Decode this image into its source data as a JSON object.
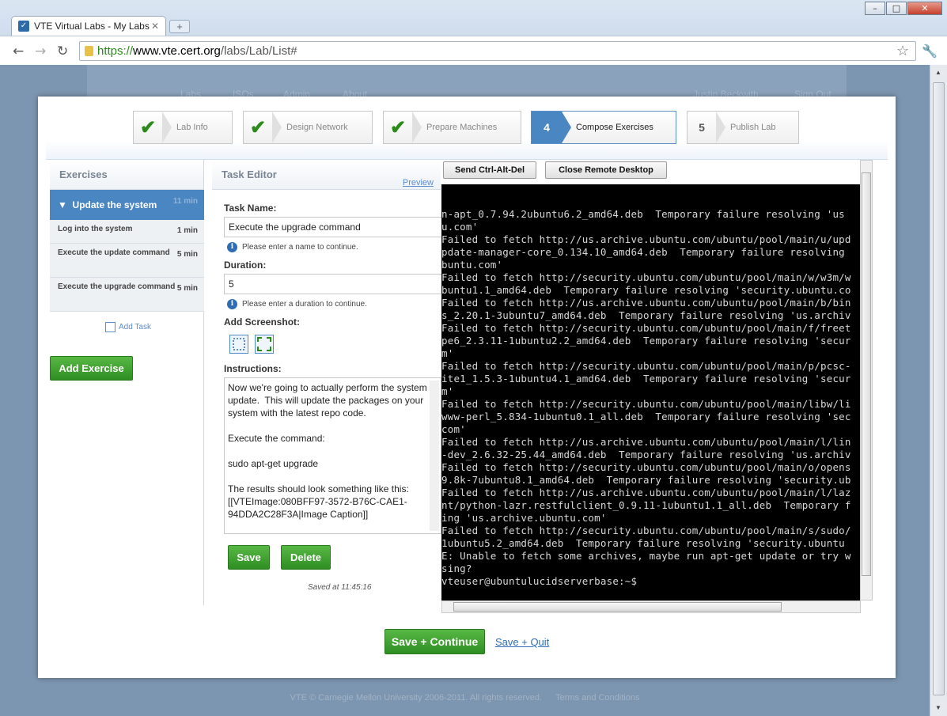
{
  "browser": {
    "tab_title": "VTE Virtual Labs - My Labs",
    "url_scheme": "https://",
    "url_host": "www.vte.cert.org",
    "url_path": "/labs/Lab/List#"
  },
  "site": {
    "nav": [
      "Labs",
      "ISOs",
      "Admin",
      "About"
    ],
    "user": "Justin Beckwith",
    "signout": "Sign Out",
    "footer": "VTE © Carnegie Mellon University 2006-2011. All rights reserved.",
    "footer_link": "Terms and Conditions"
  },
  "wizard": {
    "steps": [
      {
        "label": "Lab Info",
        "state": "done"
      },
      {
        "label": "Design Network",
        "state": "done"
      },
      {
        "label": "Prepare Machines",
        "state": "done"
      },
      {
        "num": "4",
        "label": "Compose Exercises",
        "state": "active"
      },
      {
        "num": "5",
        "label": "Publish Lab",
        "state": "pending"
      }
    ]
  },
  "exercises": {
    "header": "Exercises",
    "selected": {
      "title": "Update the system",
      "duration": "11 min"
    },
    "tasks": [
      {
        "title": "Log into the system",
        "duration": "1 min"
      },
      {
        "title": "Execute the update command",
        "duration": "5 min"
      },
      {
        "title": "Execute the upgrade command",
        "duration": "5 min"
      }
    ],
    "add_task": "Add Task",
    "add_exercise": "Add Exercise"
  },
  "editor": {
    "header": "Task Editor",
    "preview": "Preview",
    "task_name_label": "Task Name:",
    "task_name": "Execute the upgrade command",
    "task_name_hint": "Please enter a name to continue.",
    "duration_label": "Duration:",
    "duration": "5",
    "duration_hint": "Please enter a duration to continue.",
    "screenshot_label": "Add Screenshot:",
    "instructions_label": "Instructions:",
    "instructions": "Now we're going to actually perform the system update.  This will update the packages on your system with the latest repo code.\n\nExecute the command:\n\nsudo apt-get upgrade\n\nThe results should look something like this:\n[[VTEImage:080BFF97-3572-B76C-CAE1-94DDA2C28F3A|Image Caption]]",
    "save": "Save",
    "delete": "Delete",
    "saved_at": "Saved at 11:45:16"
  },
  "remote": {
    "send_cad": "Send Ctrl-Alt-Del",
    "close": "Close Remote Desktop",
    "terminal": "n-apt_0.7.94.2ubuntu6.2_amd64.deb  Temporary failure resolving 'us\nu.com'\nFailed to fetch http://us.archive.ubuntu.com/ubuntu/pool/main/u/upd\npdate-manager-core_0.134.10_amd64.deb  Temporary failure resolving\nbuntu.com'\nFailed to fetch http://security.ubuntu.com/ubuntu/pool/main/w/w3m/w\nbuntu1.1_amd64.deb  Temporary failure resolving 'security.ubuntu.co\nFailed to fetch http://us.archive.ubuntu.com/ubuntu/pool/main/b/bin\ns_2.20.1-3ubuntu7_amd64.deb  Temporary failure resolving 'us.archiv\nFailed to fetch http://security.ubuntu.com/ubuntu/pool/main/f/freet\npe6_2.3.11-1ubuntu2.2_amd64.deb  Temporary failure resolving 'secur\nm'\nFailed to fetch http://security.ubuntu.com/ubuntu/pool/main/p/pcsc-\nite1_1.5.3-1ubuntu4.1_amd64.deb  Temporary failure resolving 'secur\nm'\nFailed to fetch http://security.ubuntu.com/ubuntu/pool/main/libw/li\nwww-perl_5.834-1ubuntu0.1_all.deb  Temporary failure resolving 'sec\ncom'\nFailed to fetch http://us.archive.ubuntu.com/ubuntu/pool/main/l/lin\n-dev_2.6.32-25.44_amd64.deb  Temporary failure resolving 'us.archiv\nFailed to fetch http://security.ubuntu.com/ubuntu/pool/main/o/opens\n9.8k-7ubuntu8.1_amd64.deb  Temporary failure resolving 'security.ub\nFailed to fetch http://us.archive.ubuntu.com/ubuntu/pool/main/l/laz\nnt/python-lazr.restfulclient_0.9.11-1ubuntu1.1_all.deb  Temporary f\ning 'us.archive.ubuntu.com'\nFailed to fetch http://security.ubuntu.com/ubuntu/pool/main/s/sudo/\n1ubuntu5.2_amd64.deb  Temporary failure resolving 'security.ubuntu\nE: Unable to fetch some archives, maybe run apt-get update or try w\nsing?\nvteuser@ubuntulucidserverbase:~$"
  },
  "actions": {
    "save_continue": "Save + Continue",
    "save_quit": "Save + Quit"
  },
  "colors": {
    "accent": "#4a86c2",
    "green": "#3a9a2a"
  }
}
